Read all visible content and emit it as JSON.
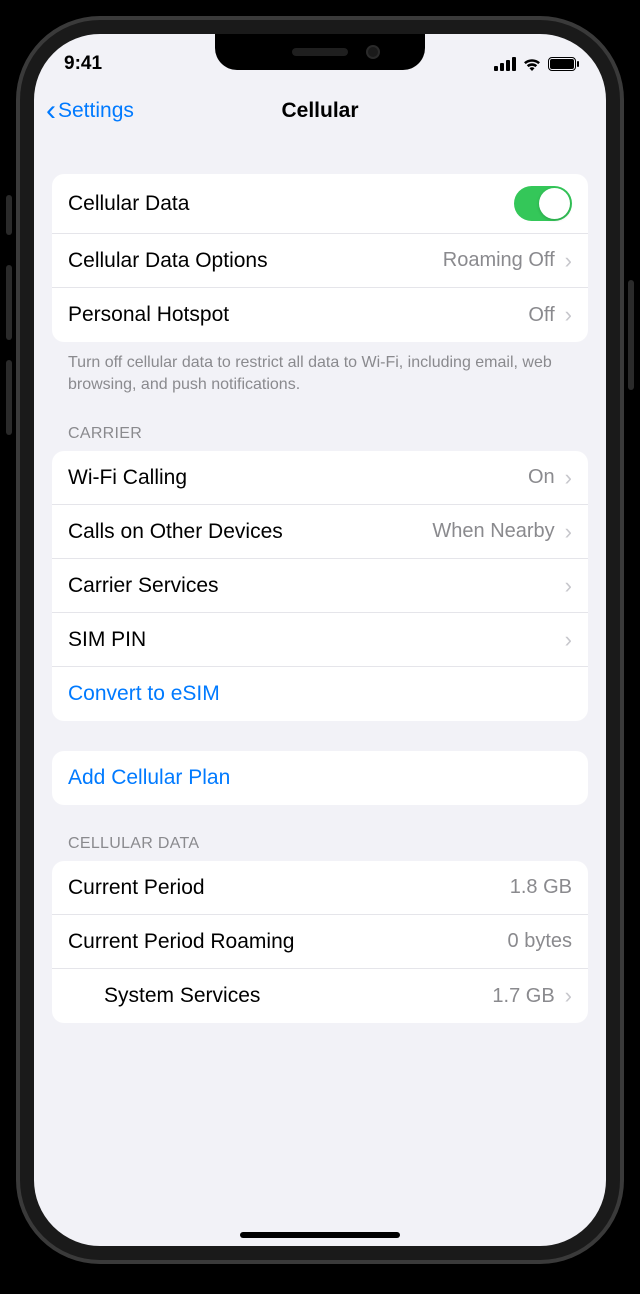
{
  "status": {
    "time": "9:41"
  },
  "nav": {
    "back": "Settings",
    "title": "Cellular"
  },
  "section1": {
    "cellular_data": {
      "label": "Cellular Data",
      "on": true
    },
    "data_options": {
      "label": "Cellular Data Options",
      "value": "Roaming Off"
    },
    "hotspot": {
      "label": "Personal Hotspot",
      "value": "Off"
    },
    "footer": "Turn off cellular data to restrict all data to Wi-Fi, including email, web browsing, and push notifications."
  },
  "carrier": {
    "header": "Carrier",
    "wifi_calling": {
      "label": "Wi-Fi Calling",
      "value": "On"
    },
    "other_devices": {
      "label": "Calls on Other Devices",
      "value": "When Nearby"
    },
    "services": {
      "label": "Carrier Services"
    },
    "sim_pin": {
      "label": "SIM PIN"
    },
    "convert_esim": {
      "label": "Convert to eSIM"
    }
  },
  "add_plan": {
    "label": "Add Cellular Plan"
  },
  "usage": {
    "header": "Cellular Data",
    "current": {
      "label": "Current Period",
      "value": "1.8 GB"
    },
    "roaming": {
      "label": "Current Period Roaming",
      "value": "0 bytes"
    },
    "system": {
      "label": "System Services",
      "value": "1.7 GB"
    }
  }
}
